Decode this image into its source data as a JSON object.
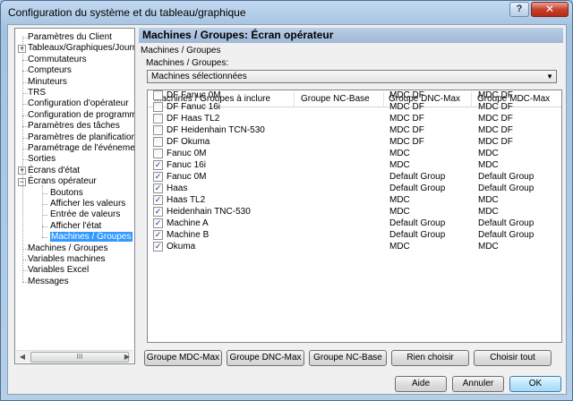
{
  "window": {
    "title": "Configuration du système et du tableau/graphique",
    "help_label": "?",
    "close_label": "✕"
  },
  "tree": {
    "items": [
      {
        "label": "Paramètres du Client",
        "level": 0,
        "expander": ""
      },
      {
        "label": "Tableaux/Graphiques/Journal",
        "level": 0,
        "expander": "+"
      },
      {
        "label": "Commutateurs",
        "level": 0,
        "expander": ""
      },
      {
        "label": "Compteurs",
        "level": 0,
        "expander": ""
      },
      {
        "label": "Minuteurs",
        "level": 0,
        "expander": ""
      },
      {
        "label": "TRS",
        "level": 0,
        "expander": ""
      },
      {
        "label": "Configuration d'opérateur",
        "level": 0,
        "expander": ""
      },
      {
        "label": "Configuration de programme",
        "level": 0,
        "expander": ""
      },
      {
        "label": "Paramètres des tâches",
        "level": 0,
        "expander": ""
      },
      {
        "label": "Paramètres de planification",
        "level": 0,
        "expander": ""
      },
      {
        "label": "Paramétrage de l'événement",
        "level": 0,
        "expander": ""
      },
      {
        "label": "Sorties",
        "level": 0,
        "expander": ""
      },
      {
        "label": "Écrans d'état",
        "level": 0,
        "expander": "+"
      },
      {
        "label": "Écrans opérateur",
        "level": 0,
        "expander": "−"
      },
      {
        "label": "Boutons",
        "level": 1,
        "expander": ""
      },
      {
        "label": "Afficher les valeurs",
        "level": 1,
        "expander": ""
      },
      {
        "label": "Entrée de valeurs",
        "level": 1,
        "expander": ""
      },
      {
        "label": "Afficher l'état",
        "level": 1,
        "expander": ""
      },
      {
        "label": "Machines / Groupes",
        "level": 1,
        "expander": "",
        "selected": true
      },
      {
        "label": "Machines / Groupes",
        "level": 0,
        "expander": ""
      },
      {
        "label": "Variables machines",
        "level": 0,
        "expander": ""
      },
      {
        "label": "Variables Excel",
        "level": 0,
        "expander": ""
      },
      {
        "label": "Messages",
        "level": 0,
        "expander": ""
      }
    ],
    "scroll_grip": "III"
  },
  "panel": {
    "header": "Machines / Groupes: Écran opérateur",
    "group_label": "Machines / Groupes",
    "field_label": "Machines / Groupes:",
    "combo_value": "Machines sélectionnées"
  },
  "table": {
    "columns": [
      "Machines / Groupes à inclure",
      "Groupe NC-Base",
      "Groupe DNC-Max",
      "Groupe MDC-Max"
    ],
    "rows": [
      {
        "checked": false,
        "name": "DF Fanuc 0M",
        "nc": "",
        "dnc": "MDC DF",
        "mdc": "MDC DF"
      },
      {
        "checked": false,
        "name": "DF Fanuc 16i",
        "nc": "",
        "dnc": "MDC DF",
        "mdc": "MDC DF"
      },
      {
        "checked": false,
        "name": "DF Haas TL2",
        "nc": "",
        "dnc": "MDC DF",
        "mdc": "MDC DF"
      },
      {
        "checked": false,
        "name": "DF Heidenhain TCN-530",
        "nc": "",
        "dnc": "MDC DF",
        "mdc": "MDC DF"
      },
      {
        "checked": false,
        "name": "DF Okuma",
        "nc": "",
        "dnc": "MDC DF",
        "mdc": "MDC DF"
      },
      {
        "checked": false,
        "name": "Fanuc 0M",
        "nc": "",
        "dnc": "MDC",
        "mdc": "MDC"
      },
      {
        "checked": true,
        "name": "Fanuc 16i",
        "nc": "",
        "dnc": "MDC",
        "mdc": "MDC"
      },
      {
        "checked": true,
        "name": "Fanuc 0M",
        "nc": "",
        "dnc": "Default Group",
        "mdc": "Default Group"
      },
      {
        "checked": true,
        "name": "Haas",
        "nc": "",
        "dnc": "Default Group",
        "mdc": "Default Group"
      },
      {
        "checked": true,
        "name": "Haas TL2",
        "nc": "",
        "dnc": "MDC",
        "mdc": "MDC"
      },
      {
        "checked": true,
        "name": "Heidenhain TNC-530",
        "nc": "",
        "dnc": "MDC",
        "mdc": "MDC"
      },
      {
        "checked": true,
        "name": "Machine A",
        "nc": "",
        "dnc": "Default Group",
        "mdc": "Default Group"
      },
      {
        "checked": true,
        "name": "Machine B",
        "nc": "",
        "dnc": "Default Group",
        "mdc": "Default Group"
      },
      {
        "checked": true,
        "name": "Okuma",
        "nc": "",
        "dnc": "MDC",
        "mdc": "MDC"
      }
    ]
  },
  "actions": {
    "group_mdc_max": "Groupe MDC-Max",
    "group_dnc_max": "Groupe DNC-Max",
    "group_nc_base": "Groupe NC-Base",
    "choose_none": "Rien choisir",
    "choose_all": "Choisir tout"
  },
  "footer": {
    "help": "Aide",
    "cancel": "Annuler",
    "ok": "OK"
  }
}
